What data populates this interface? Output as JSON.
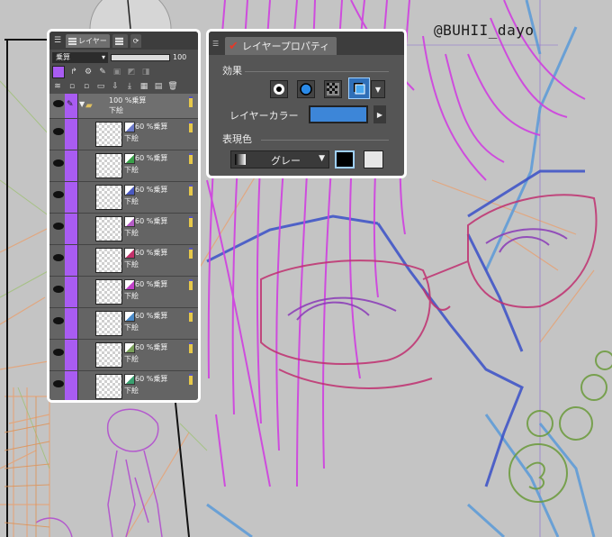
{
  "watermark": "@BUHII_dayo",
  "layer_panel": {
    "tab_label": "レイヤー",
    "blend_mode": "乗算",
    "opacity_value": "100",
    "layer_color": "#a95cf2",
    "folder": {
      "mode": "100 %乗算",
      "name": "下絵"
    },
    "layers": [
      {
        "mode": "60 %乗算",
        "name": "下絵",
        "mark_color": "#6b79c8"
      },
      {
        "mode": "60 %乗算",
        "name": "下絵",
        "mark_color": "#3aa04a"
      },
      {
        "mode": "60 %乗算",
        "name": "下絵",
        "mark_color": "#4a59c0"
      },
      {
        "mode": "60 %乗算",
        "name": "下絵",
        "mark_color": "#b45cc6"
      },
      {
        "mode": "60 %乗算",
        "name": "下絵",
        "mark_color": "#c2306a"
      },
      {
        "mode": "60 %乗算",
        "name": "下絵",
        "mark_color": "#c040c8"
      },
      {
        "mode": "60 %乗算",
        "name": "下絵",
        "mark_color": "#4a8ac8"
      },
      {
        "mode": "60 %乗算",
        "name": "下絵",
        "mark_color": "#7aa05a"
      },
      {
        "mode": "60 %乗算",
        "name": "下絵",
        "mark_color": "#3aa070"
      }
    ]
  },
  "property_panel": {
    "tab_label": "レイヤープロパティ",
    "effect_label": "効果",
    "layer_color_label": "レイヤーカラー",
    "layer_color": "#3d86d8",
    "expression_label": "表現色",
    "expression_value": "グレー"
  }
}
